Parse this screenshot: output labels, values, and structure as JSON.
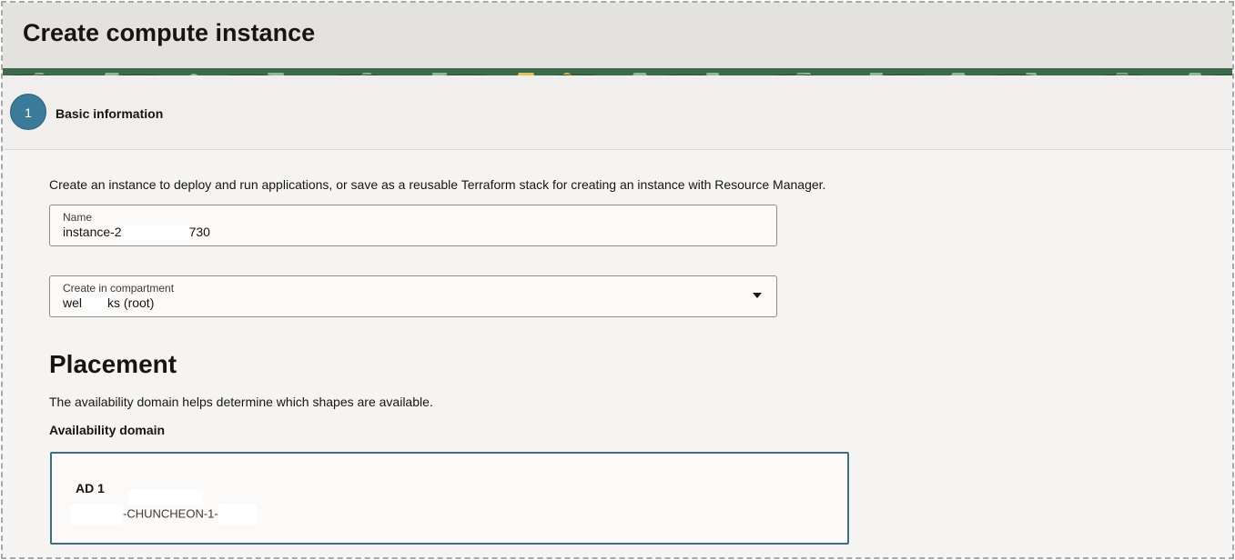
{
  "header": {
    "title": "Create compute instance"
  },
  "step": {
    "number": "1",
    "label": "Basic information"
  },
  "intro_text": "Create an instance to deploy and run applications, or save as a reusable Terraform stack for creating an instance with Resource Manager.",
  "name_field": {
    "label": "Name",
    "value_start": "instance-2",
    "value_end": "730"
  },
  "compartment_field": {
    "label": "Create in compartment",
    "value_start": "wel",
    "value_end": "ks (root)"
  },
  "placement": {
    "heading": "Placement",
    "description": "The availability domain helps determine which shapes are available.",
    "ad_label": "Availability domain",
    "selected_ad": {
      "title": "AD 1",
      "region": "-CHUNCHEON-1-"
    }
  },
  "colors": {
    "accent_blue": "#3b7a99",
    "selected_border": "#3b7080",
    "banner_green": "#3d6b4a"
  },
  "icons": {
    "compartment_dropdown": "chevron-down-icon"
  }
}
